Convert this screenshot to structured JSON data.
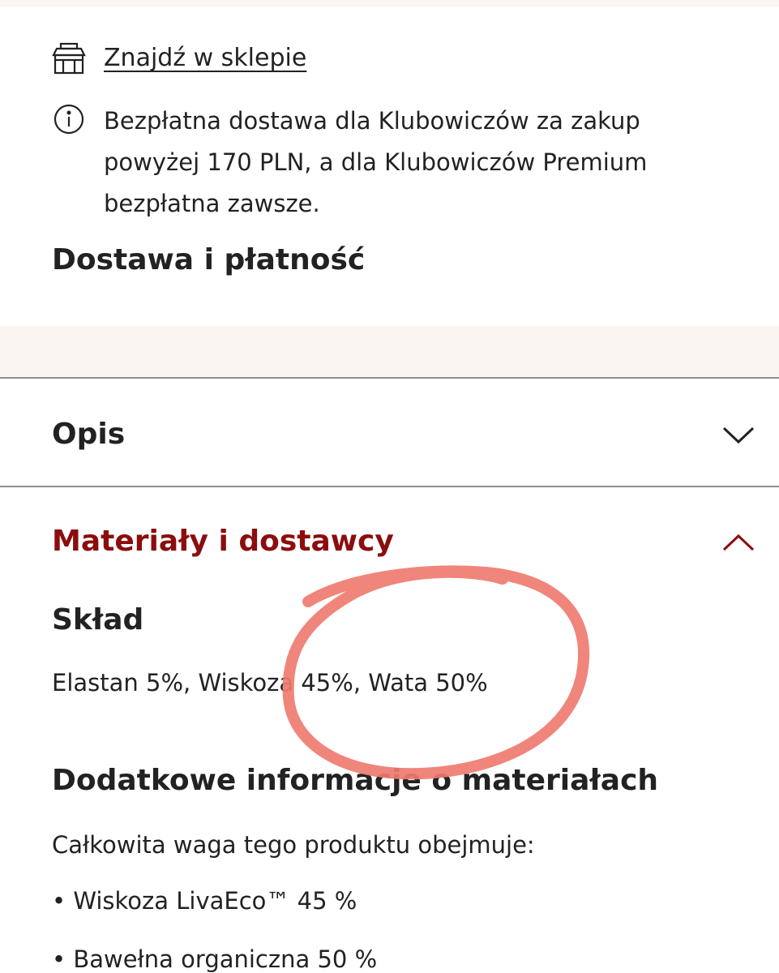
{
  "store": {
    "label": "Znajdź w sklepie",
    "icon": "store-icon"
  },
  "info": {
    "icon": "info-icon",
    "lines": [
      "Bezpłatna dostawa dla Klubowiczów za zakup",
      "powyżej 170 PLN, a dla Klubowiczów Premium",
      "bezpłatna zawsze."
    ]
  },
  "delivery": {
    "title": "Dostawa i płatność"
  },
  "accordion": {
    "description": {
      "title": "Opis",
      "icon": "chevron-down-icon"
    },
    "materials": {
      "title": "Materiały i dostawcy",
      "icon": "chevron-up-icon",
      "color": "#8b0d0d"
    }
  },
  "composition": {
    "heading": "Skład",
    "text": "Elastan 5%, Wiskoza 45%, Wata 50%"
  },
  "additional": {
    "heading": "Dodatkowe informacje o materiałach",
    "intro": "Całkowita waga tego produktu obejmuje:",
    "items": [
      "• Wiskoza LivaEco™ 45 %",
      "• Bawełna organiczna 50 %"
    ]
  },
  "annotation": {
    "color": "#ef7b70"
  }
}
